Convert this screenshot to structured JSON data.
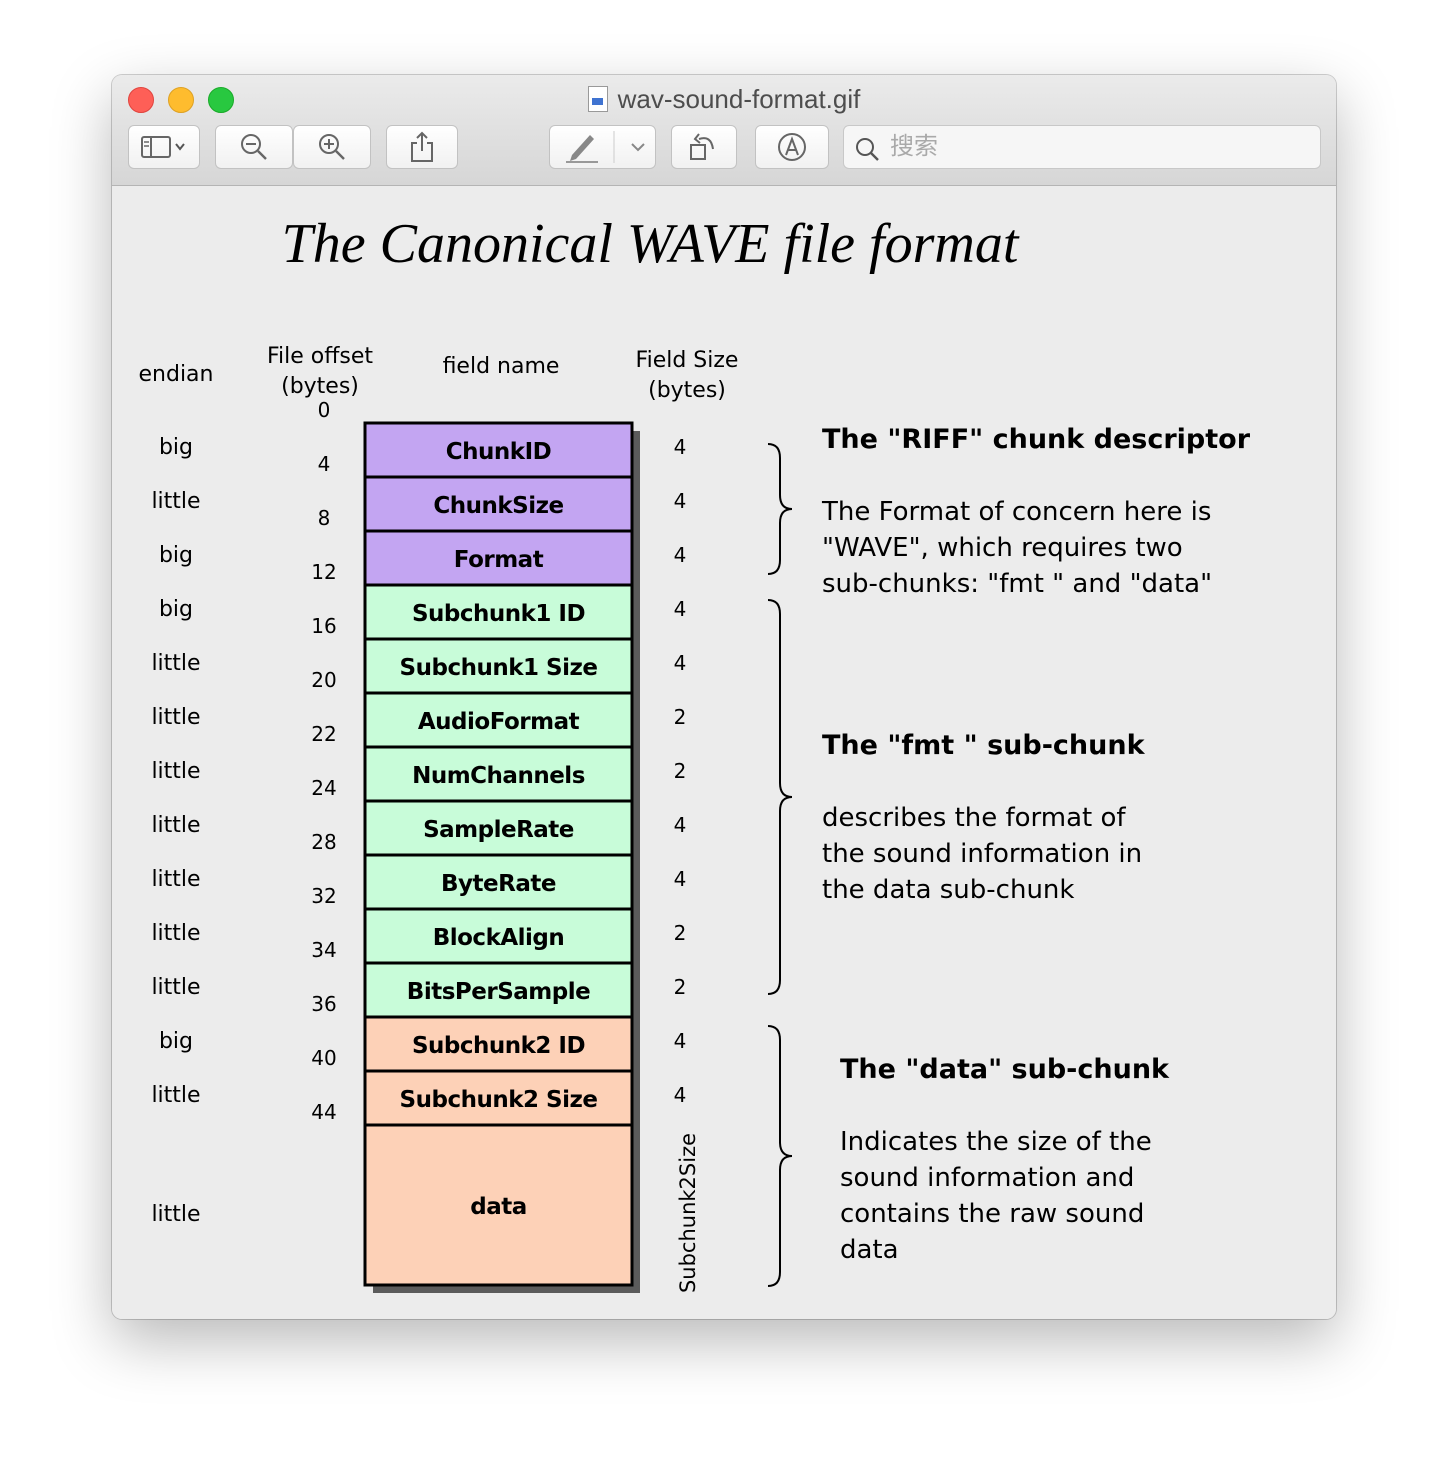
{
  "window": {
    "title": "wav-sound-format.gif",
    "search_placeholder": "搜索"
  },
  "figure": {
    "title": "The Canonical WAVE file format",
    "headers": {
      "endian": "endian",
      "offset_line1": "File offset",
      "offset_line2": "(bytes)",
      "field_name": "field name",
      "size_line1": "Field Size",
      "size_line2": "(bytes)"
    },
    "colors": {
      "riff": "#c3a5f2",
      "fmt": "#c8fcd9",
      "data": "#fdd1b7"
    },
    "offsets": [
      "0",
      "4",
      "8",
      "12",
      "16",
      "20",
      "22",
      "24",
      "28",
      "32",
      "34",
      "36",
      "40",
      "44"
    ],
    "fields": [
      {
        "name": "ChunkID",
        "endian": "big",
        "size": "4",
        "group": "riff"
      },
      {
        "name": "ChunkSize",
        "endian": "little",
        "size": "4",
        "group": "riff"
      },
      {
        "name": "Format",
        "endian": "big",
        "size": "4",
        "group": "riff"
      },
      {
        "name": "Subchunk1 ID",
        "endian": "big",
        "size": "4",
        "group": "fmt"
      },
      {
        "name": "Subchunk1 Size",
        "endian": "little",
        "size": "4",
        "group": "fmt"
      },
      {
        "name": "AudioFormat",
        "endian": "little",
        "size": "2",
        "group": "fmt"
      },
      {
        "name": "NumChannels",
        "endian": "little",
        "size": "2",
        "group": "fmt"
      },
      {
        "name": "SampleRate",
        "endian": "little",
        "size": "4",
        "group": "fmt"
      },
      {
        "name": "ByteRate",
        "endian": "little",
        "size": "4",
        "group": "fmt"
      },
      {
        "name": "BlockAlign",
        "endian": "little",
        "size": "2",
        "group": "fmt"
      },
      {
        "name": "BitsPerSample",
        "endian": "little",
        "size": "2",
        "group": "fmt"
      },
      {
        "name": "Subchunk2 ID",
        "endian": "big",
        "size": "4",
        "group": "data"
      },
      {
        "name": "Subchunk2 Size",
        "endian": "little",
        "size": "4",
        "group": "data"
      },
      {
        "name": "data",
        "endian": "little",
        "size": "Subchunk2Size",
        "group": "data"
      }
    ],
    "riff": {
      "heading": "The \"RIFF\" chunk descriptor",
      "lines": [
        "The Format of concern here is",
        "\"WAVE\", which requires two",
        "sub-chunks: \"fmt \" and \"data\""
      ]
    },
    "fmt": {
      "heading": "The \"fmt \" sub-chunk",
      "lines": [
        "describes the format of",
        "the sound information in",
        "the data sub-chunk"
      ]
    },
    "data": {
      "heading": "The \"data\" sub-chunk",
      "lines": [
        "Indicates the size of the",
        "sound information and",
        "contains the raw sound",
        "data"
      ]
    }
  }
}
